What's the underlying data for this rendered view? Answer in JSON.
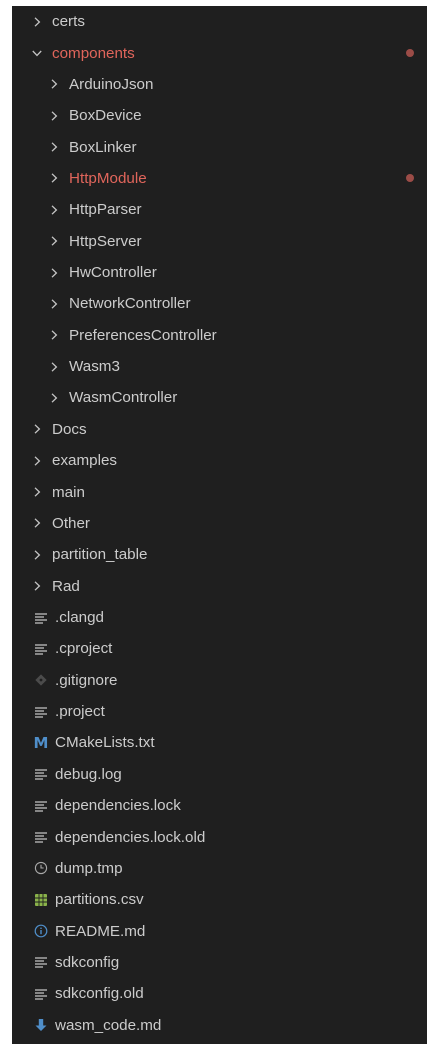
{
  "explorer": {
    "items": [
      {
        "label": "certs",
        "kind": "folder",
        "state": "collapsed",
        "level": 0,
        "icon": "chevron-right-icon"
      },
      {
        "label": "components",
        "kind": "folder",
        "state": "expanded",
        "level": 0,
        "modified": true,
        "icon": "chevron-down-icon"
      },
      {
        "label": "ArduinoJson",
        "kind": "folder",
        "state": "collapsed",
        "level": 1,
        "icon": "chevron-right-icon"
      },
      {
        "label": "BoxDevice",
        "kind": "folder",
        "state": "collapsed",
        "level": 1,
        "icon": "chevron-right-icon"
      },
      {
        "label": "BoxLinker",
        "kind": "folder",
        "state": "collapsed",
        "level": 1,
        "icon": "chevron-right-icon"
      },
      {
        "label": "HttpModule",
        "kind": "folder",
        "state": "collapsed",
        "level": 1,
        "modified": true,
        "icon": "chevron-right-icon"
      },
      {
        "label": "HttpParser",
        "kind": "folder",
        "state": "collapsed",
        "level": 1,
        "icon": "chevron-right-icon"
      },
      {
        "label": "HttpServer",
        "kind": "folder",
        "state": "collapsed",
        "level": 1,
        "icon": "chevron-right-icon"
      },
      {
        "label": "HwController",
        "kind": "folder",
        "state": "collapsed",
        "level": 1,
        "icon": "chevron-right-icon"
      },
      {
        "label": "NetworkController",
        "kind": "folder",
        "state": "collapsed",
        "level": 1,
        "icon": "chevron-right-icon"
      },
      {
        "label": "PreferencesController",
        "kind": "folder",
        "state": "collapsed",
        "level": 1,
        "icon": "chevron-right-icon"
      },
      {
        "label": "Wasm3",
        "kind": "folder",
        "state": "collapsed",
        "level": 1,
        "icon": "chevron-right-icon"
      },
      {
        "label": "WasmController",
        "kind": "folder",
        "state": "collapsed",
        "level": 1,
        "icon": "chevron-right-icon"
      },
      {
        "label": "Docs",
        "kind": "folder",
        "state": "collapsed",
        "level": 0,
        "icon": "chevron-right-icon"
      },
      {
        "label": "examples",
        "kind": "folder",
        "state": "collapsed",
        "level": 0,
        "icon": "chevron-right-icon"
      },
      {
        "label": "main",
        "kind": "folder",
        "state": "collapsed",
        "level": 0,
        "icon": "chevron-right-icon"
      },
      {
        "label": "Other",
        "kind": "folder",
        "state": "collapsed",
        "level": 0,
        "icon": "chevron-right-icon"
      },
      {
        "label": "partition_table",
        "kind": "folder",
        "state": "collapsed",
        "level": 0,
        "icon": "chevron-right-icon"
      },
      {
        "label": "Rad",
        "kind": "folder",
        "state": "collapsed",
        "level": 0,
        "icon": "chevron-right-icon"
      },
      {
        "label": ".clangd",
        "kind": "file",
        "level": 0,
        "icon": "lines-file-icon"
      },
      {
        "label": ".cproject",
        "kind": "file",
        "level": 0,
        "icon": "lines-file-icon"
      },
      {
        "label": ".gitignore",
        "kind": "file",
        "level": 0,
        "icon": "git-diamond-icon"
      },
      {
        "label": ".project",
        "kind": "file",
        "level": 0,
        "icon": "lines-file-icon"
      },
      {
        "label": "CMakeLists.txt",
        "kind": "file",
        "level": 0,
        "icon": "cmake-m-icon",
        "badge_text": "M"
      },
      {
        "label": "debug.log",
        "kind": "file",
        "level": 0,
        "icon": "lines-file-icon"
      },
      {
        "label": "dependencies.lock",
        "kind": "file",
        "level": 0,
        "icon": "lines-file-icon"
      },
      {
        "label": "dependencies.lock.old",
        "kind": "file",
        "level": 0,
        "icon": "lines-file-icon"
      },
      {
        "label": "dump.tmp",
        "kind": "file",
        "level": 0,
        "icon": "clock-icon"
      },
      {
        "label": "partitions.csv",
        "kind": "file",
        "level": 0,
        "icon": "spreadsheet-icon"
      },
      {
        "label": "README.md",
        "kind": "file",
        "level": 0,
        "icon": "info-icon"
      },
      {
        "label": "sdkconfig",
        "kind": "file",
        "level": 0,
        "icon": "lines-file-icon"
      },
      {
        "label": "sdkconfig.old",
        "kind": "file",
        "level": 0,
        "icon": "lines-file-icon"
      },
      {
        "label": "wasm_code.md",
        "kind": "file",
        "level": 0,
        "icon": "download-arrow-icon"
      }
    ]
  },
  "colors": {
    "background": "#1f1f1f",
    "text": "#cccccc",
    "modified_text": "#e0655b",
    "modified_dot": "#9b4c47",
    "icon_gray": "#a9a9a9",
    "cmake_blue": "#4f8ec9",
    "csv_green": "#8ab34a",
    "info_blue": "#4f8ec9"
  }
}
